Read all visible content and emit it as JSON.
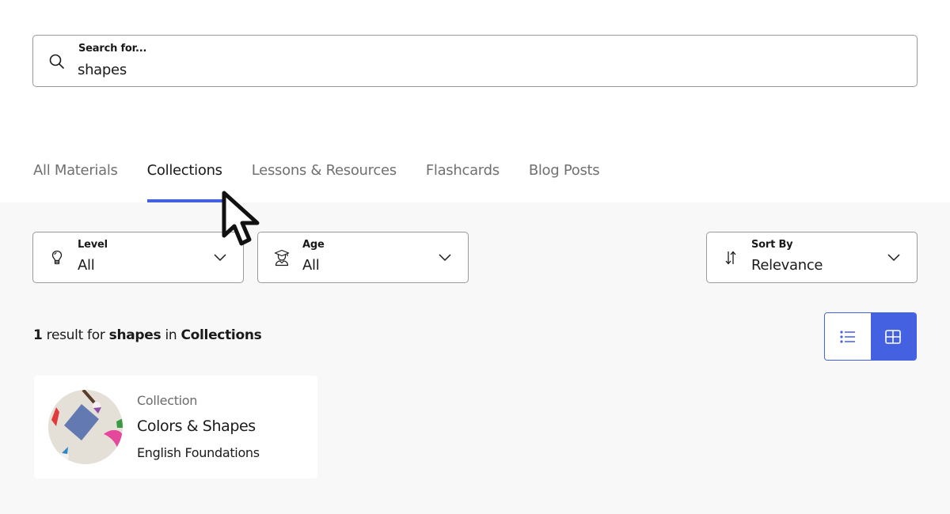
{
  "search": {
    "label": "Search for...",
    "value": "shapes",
    "icon": "search-icon"
  },
  "tabs": [
    {
      "label": "All Materials",
      "active": false
    },
    {
      "label": "Collections",
      "active": true
    },
    {
      "label": "Lessons & Resources",
      "active": false
    },
    {
      "label": "Flashcards",
      "active": false
    },
    {
      "label": "Blog Posts",
      "active": false
    }
  ],
  "filters": {
    "level": {
      "label": "Level",
      "value": "All",
      "icon": "lightbulb-icon"
    },
    "age": {
      "label": "Age",
      "value": "All",
      "icon": "graduate-icon"
    },
    "sort": {
      "label": "Sort By",
      "value": "Relevance",
      "icon": "sort-arrows-icon"
    }
  },
  "results": {
    "count": "1",
    "text_result_for": "result for",
    "query": "shapes",
    "text_in": "in",
    "category": "Collections"
  },
  "view_toggle": {
    "list_icon": "list-view-icon",
    "grid_icon": "grid-view-icon",
    "active": "grid"
  },
  "cards": [
    {
      "type": "Collection",
      "title": "Colors & Shapes",
      "subtitle": "English Foundations"
    }
  ],
  "colors": {
    "accent": "#4361e0",
    "page_bg": "#f8f8f8",
    "muted_text": "#707070"
  }
}
